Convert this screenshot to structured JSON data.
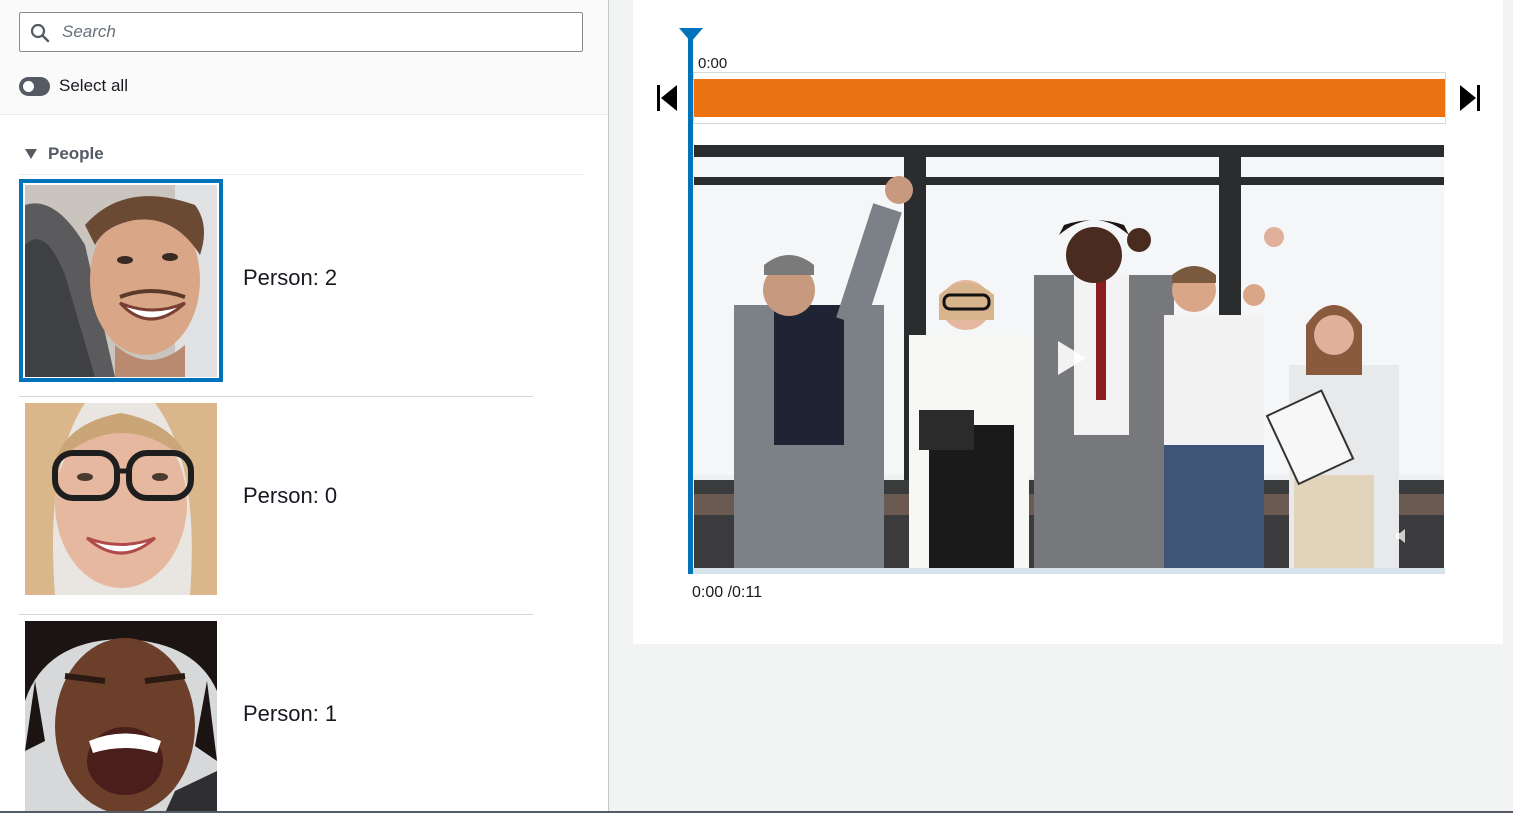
{
  "search": {
    "placeholder": "Search",
    "icon": "search-icon"
  },
  "select_all": {
    "label": "Select all",
    "enabled": false
  },
  "people_section": {
    "title": "People",
    "expanded": true,
    "items": [
      {
        "label": "Person: 2",
        "selected": true
      },
      {
        "label": "Person: 0",
        "selected": false
      },
      {
        "label": "Person: 1",
        "selected": false
      }
    ]
  },
  "player": {
    "timeline_start": "0:00",
    "time_display": "0:00 /0:11",
    "segment_color": "#ec7211",
    "playhead_color": "#0073bb",
    "segment_start_fraction": 0.0,
    "segment_end_fraction": 1.0
  },
  "colors": {
    "accent": "#0073bb",
    "segment": "#ec7211"
  }
}
